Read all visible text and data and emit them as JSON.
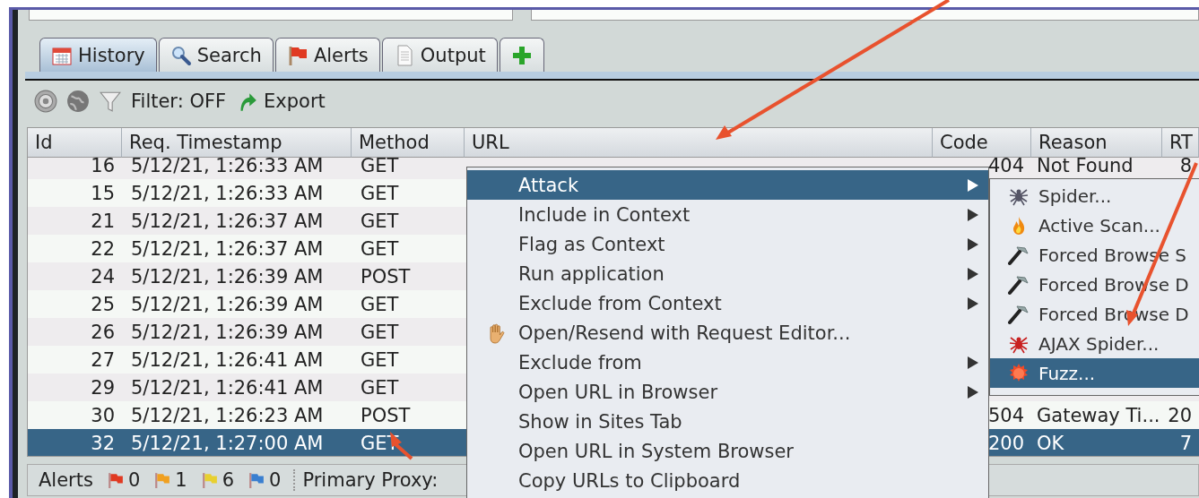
{
  "tabs": [
    {
      "label": "History",
      "kind": "calendar",
      "selected": true
    },
    {
      "label": "Search",
      "kind": "magnifier",
      "selected": false
    },
    {
      "label": "Alerts",
      "kind": "flag",
      "selected": false
    },
    {
      "label": "Output",
      "kind": "document",
      "selected": false
    },
    {
      "kind": "add",
      "selected": false
    }
  ],
  "toolbar": {
    "filter_label": "Filter: OFF",
    "export_label": "Export"
  },
  "table": {
    "columns": [
      "Id",
      "Req. Timestamp",
      "Method",
      "URL",
      "Code",
      "Reason",
      "RT"
    ],
    "rows": [
      {
        "id": "16",
        "timestamp": "5/12/21, 1:26:33 AM",
        "method": "GET",
        "code": "404",
        "reason": "Not Found",
        "rtt": "8",
        "selected": false
      },
      {
        "id": "15",
        "timestamp": "5/12/21, 1:26:33 AM",
        "method": "GET",
        "selected": false
      },
      {
        "id": "21",
        "timestamp": "5/12/21, 1:26:37 AM",
        "method": "GET",
        "selected": false
      },
      {
        "id": "22",
        "timestamp": "5/12/21, 1:26:37 AM",
        "method": "GET",
        "selected": false
      },
      {
        "id": "24",
        "timestamp": "5/12/21, 1:26:39 AM",
        "method": "POST",
        "selected": false
      },
      {
        "id": "25",
        "timestamp": "5/12/21, 1:26:39 AM",
        "method": "GET",
        "selected": false
      },
      {
        "id": "26",
        "timestamp": "5/12/21, 1:26:39 AM",
        "method": "GET",
        "selected": false
      },
      {
        "id": "27",
        "timestamp": "5/12/21, 1:26:41 AM",
        "method": "GET",
        "selected": false
      },
      {
        "id": "29",
        "timestamp": "5/12/21, 1:26:41 AM",
        "method": "GET",
        "selected": false
      },
      {
        "id": "30",
        "timestamp": "5/12/21, 1:26:23 AM",
        "method": "POST",
        "code": "504",
        "reason": "Gateway Ti...",
        "rtt": "20",
        "selected": false
      },
      {
        "id": "32",
        "timestamp": "5/12/21, 1:27:00 AM",
        "method": "GET",
        "code": "200",
        "reason": "OK",
        "rtt": "7",
        "selected": true
      }
    ]
  },
  "context_menu": {
    "items": [
      {
        "label": "Attack",
        "kind": "plain",
        "submenu": true,
        "selected": true
      },
      {
        "label": "Include in Context",
        "kind": "plain",
        "submenu": true,
        "selected": false
      },
      {
        "label": "Flag as Context",
        "kind": "plain",
        "submenu": true,
        "selected": false
      },
      {
        "label": "Run application",
        "kind": "plain",
        "submenu": true,
        "selected": false
      },
      {
        "label": "Exclude from Context",
        "kind": "plain",
        "submenu": true,
        "selected": false
      },
      {
        "label": "Open/Resend with Request Editor...",
        "kind": "hand",
        "submenu": false,
        "selected": false
      },
      {
        "label": "Exclude from",
        "kind": "plain",
        "submenu": true,
        "selected": false
      },
      {
        "label": "Open URL in Browser",
        "kind": "plain",
        "submenu": true,
        "selected": false
      },
      {
        "label": "Show in Sites Tab",
        "kind": "plain",
        "submenu": false,
        "selected": false
      },
      {
        "label": "Open URL in System Browser",
        "kind": "plain",
        "submenu": false,
        "selected": false
      },
      {
        "label": "Copy URLs to Clipboard",
        "kind": "plain",
        "submenu": false,
        "selected": false
      }
    ]
  },
  "attack_submenu": {
    "items": [
      {
        "label": "Spider...",
        "kind": "spider",
        "selected": false
      },
      {
        "label": "Active Scan...",
        "kind": "flame",
        "selected": false
      },
      {
        "label": "Forced Browse S",
        "kind": "hammer",
        "selected": false
      },
      {
        "label": "Forced Browse D",
        "kind": "hammer",
        "selected": false
      },
      {
        "label": "Forced Browse D",
        "kind": "hammer",
        "selected": false
      },
      {
        "label": "AJAX Spider...",
        "kind": "redspider",
        "selected": false
      },
      {
        "label": "Fuzz...",
        "kind": "burst",
        "selected": true
      }
    ]
  },
  "status_bar": {
    "label": "Alerts",
    "alerts": [
      {
        "count": "0",
        "color": "#e03a22"
      },
      {
        "count": "1",
        "color": "#f0a020"
      },
      {
        "count": "6",
        "color": "#e8d030"
      },
      {
        "count": "0",
        "color": "#3a7fd0"
      }
    ],
    "proxy_label": "Primary Proxy:"
  }
}
